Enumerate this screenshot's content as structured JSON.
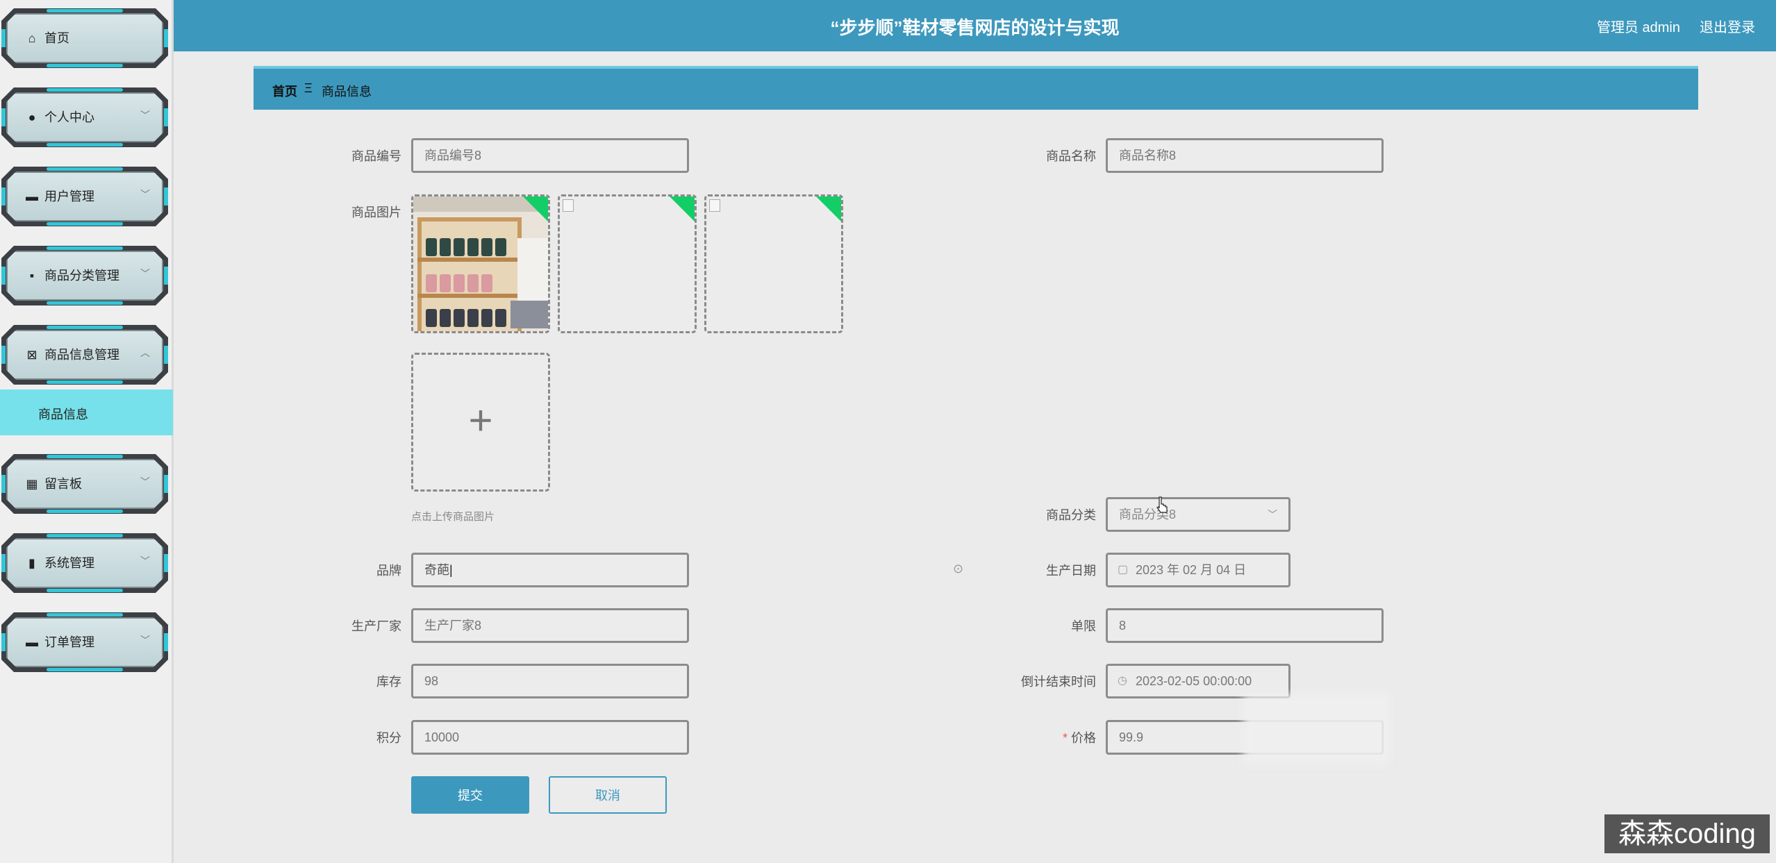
{
  "header": {
    "title": "“步步顺”鞋材零售网店的设计与实现",
    "admin_label": "管理员 admin",
    "logout_label": "退出登录"
  },
  "sidebar": {
    "items": [
      {
        "label": "首页",
        "icon": "home-icon"
      },
      {
        "label": "个人中心",
        "icon": "user-icon"
      },
      {
        "label": "用户管理",
        "icon": "monitor-icon"
      },
      {
        "label": "商品分类管理",
        "icon": "chat-icon"
      },
      {
        "label": "商品信息管理",
        "icon": "clipboard-icon"
      },
      {
        "label": "留言板",
        "icon": "grid-icon"
      },
      {
        "label": "系统管理",
        "icon": "book-icon"
      },
      {
        "label": "订单管理",
        "icon": "monitor-icon"
      }
    ],
    "active_sub": "商品信息"
  },
  "breadcrumb": {
    "home": "首页",
    "separator": "Ξ",
    "current": "商品信息"
  },
  "form": {
    "product_code": {
      "label": "商品编号",
      "placeholder": "商品编号8"
    },
    "product_name": {
      "label": "商品名称",
      "placeholder": "商品名称8"
    },
    "product_image": {
      "label": "商品图片",
      "hint": "点击上传商品图片"
    },
    "category": {
      "label": "商品分类",
      "value": "商品分类8"
    },
    "brand": {
      "label": "品牌",
      "value": "奇葩"
    },
    "production_date": {
      "label": "生产日期",
      "value": "2023 年 02 月 04 日"
    },
    "manufacturer": {
      "label": "生产厂家",
      "placeholder": "生产厂家8"
    },
    "limit": {
      "label": "单限",
      "placeholder": "8"
    },
    "stock": {
      "label": "库存",
      "placeholder": "98"
    },
    "countdown_end": {
      "label": "倒计结束时间",
      "value": "2023-02-05 00:00:00"
    },
    "points": {
      "label": "积分",
      "placeholder": "10000"
    },
    "price": {
      "label": "价格",
      "required_mark": "*",
      "placeholder": "99.9"
    },
    "submit_label": "提交",
    "cancel_label": "取消"
  },
  "watermark": "森森coding",
  "colors": {
    "header": "#3d98bd",
    "active_sub": "#76e1ea",
    "upload_corner": "#13ce66"
  }
}
